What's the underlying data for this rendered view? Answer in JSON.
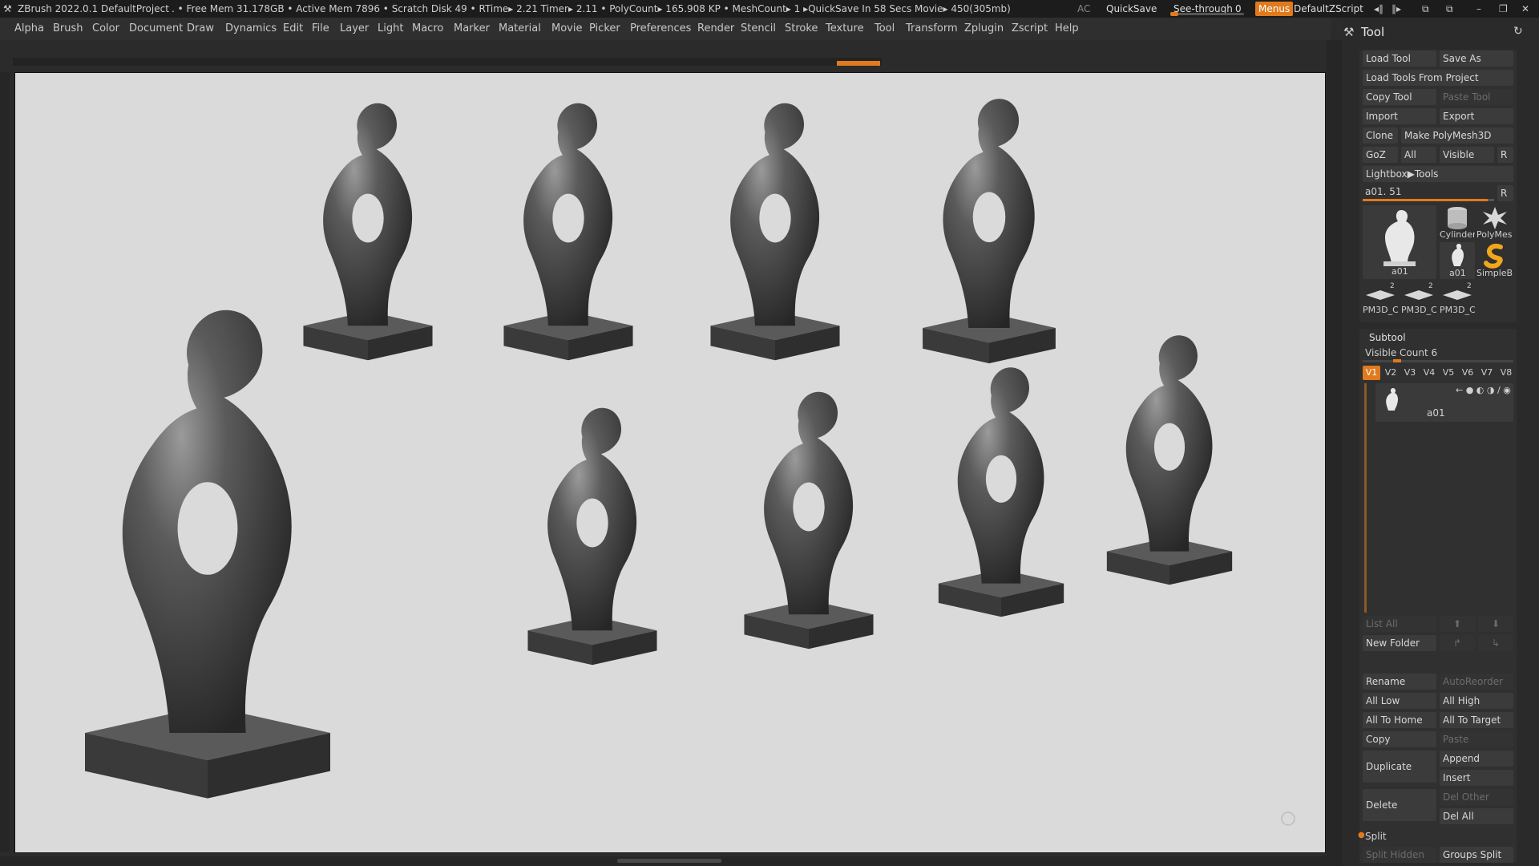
{
  "titlebar": {
    "app": "ZBrush 2022.0.1",
    "project": "DefaultProject",
    "stats": ". • Free Mem 31.178GB • Active Mem 7896 • Scratch Disk 49 •  RTime▸ 2.21 Timer▸ 2.11 • PolyCount▸ 165.908 KP  • MeshCount▸ 1   ▸QuickSave In 58 Secs Movie▸ 450(305mb)",
    "ac": "AC",
    "quicksave": "QuickSave",
    "seethrough": "See-through",
    "seethrough_value": "0",
    "seethrough_level": 0.0,
    "menus": "Menus",
    "zscript": "DefaultZScript"
  },
  "menubar": [
    "Alpha",
    "Brush",
    "Color",
    "Document",
    "Draw",
    "Dynamics",
    "Edit",
    "File",
    "Layer",
    "Light",
    "Macro",
    "Marker",
    "Material",
    "Movie",
    "Picker",
    "Preferences",
    "Render",
    "Stencil",
    "Stroke",
    "Texture",
    "Tool",
    "Transform",
    "Zplugin",
    "Zscript",
    "Help"
  ],
  "panel": {
    "title": "Tool",
    "load_tool": "Load Tool",
    "save_as": "Save As",
    "load_from_project": "Load Tools From Project",
    "copy_tool": "Copy Tool",
    "paste_tool": "Paste Tool",
    "import": "Import",
    "export": "Export",
    "clone": "Clone",
    "make_polymesh": "Make PolyMesh3D",
    "goz": "GoZ",
    "all": "All",
    "visible": "Visible",
    "r": "R",
    "lightbox_tools": "Lightbox▶Tools",
    "tool_slider_label": "a01. 51",
    "tool_slider_level": 0.95,
    "thumbs": {
      "main": "a01",
      "cylinder": "Cylinder",
      "polymesh": "PolyMes",
      "a01_small": "a01",
      "simpleb": "SimpleB",
      "pm1": "PM3D_C",
      "pm2": "PM3D_C",
      "pm3": "PM3D_C",
      "pm_count": "2"
    },
    "subtool": {
      "title": "Subtool",
      "visible_count": "Visible Count 6",
      "versions": [
        "V1",
        "V2",
        "V3",
        "V4",
        "V5",
        "V6",
        "V7",
        "V8"
      ],
      "active_version": "V1",
      "item_name": "a01",
      "list_all": "List All",
      "new_folder": "New Folder",
      "rename": "Rename",
      "autoreorder": "AutoReorder",
      "all_low": "All Low",
      "all_high": "All High",
      "all_to_home": "All To Home",
      "all_to_target": "All To Target",
      "copy": "Copy",
      "paste": "Paste",
      "duplicate": "Duplicate",
      "append": "Append",
      "insert": "Insert",
      "delete": "Delete",
      "del_other": "Del Other",
      "del_all": "Del All",
      "split": "Split",
      "split_hidden": "Split Hidden",
      "groups_split": "Groups Split"
    }
  },
  "colors": {
    "accent": "#e07a1d",
    "canvas_bg": "#dadada",
    "panel_bg": "#2a2a2a",
    "sculpt": "#4a4a4a"
  }
}
